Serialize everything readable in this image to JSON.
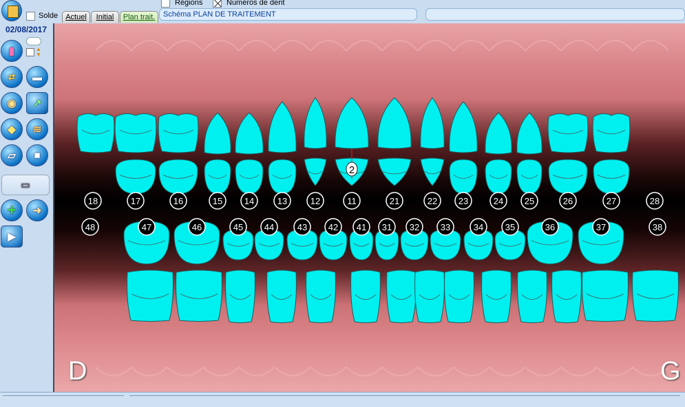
{
  "top": {
    "regions_label": "Régions",
    "tooth_numbers_label": "Numéros de dent",
    "solde_label": "Solde",
    "tabs": [
      "Actuel",
      "Initial",
      "Plan trait."
    ],
    "active_tab": "Plan trait.",
    "scheme_title": "Schéma PLAN DE TRAITEMENT"
  },
  "sidebar": {
    "date": "02/08/2017",
    "tools": [
      "pink-document-icon",
      "arrows-icon",
      "blue-bar-icon",
      "palette-icon",
      "green-tooth-icon",
      "eye-icon",
      "layers-icon",
      "scanner-icon",
      "camera-icon",
      "tray-icon",
      "add-icon",
      "import-icon",
      "video-icon"
    ]
  },
  "chart": {
    "upper_row_numbers": [
      "18",
      "17",
      "16",
      "15",
      "14",
      "13",
      "12",
      "11",
      "21",
      "22",
      "23",
      "24",
      "25",
      "26",
      "27",
      "28"
    ],
    "lower_row_numbers": [
      "48",
      "47",
      "46",
      "45",
      "44",
      "43",
      "42",
      "41",
      "31",
      "32",
      "33",
      "34",
      "35",
      "36",
      "37",
      "38"
    ],
    "empty_numbers": [
      "18",
      "28",
      "48",
      "38"
    ],
    "marker_label": "2",
    "marked_tooth": "11",
    "right_label": "D",
    "left_label": "G",
    "tooth_color": "#00f0f0",
    "gum_color": "#d9868a"
  }
}
